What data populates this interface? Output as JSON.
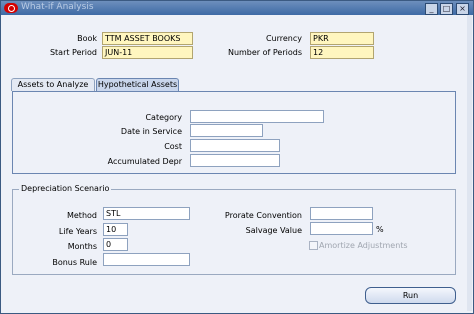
{
  "window": {
    "title": "What-if Analysis",
    "minimize_glyph": "_",
    "maximize_glyph": "□",
    "close_glyph": "×"
  },
  "header": {
    "book_label": "Book",
    "book_value": "TTM ASSET BOOKS",
    "currency_label": "Currency",
    "currency_value": "PKR",
    "start_period_label": "Start Period",
    "start_period_value": "JUN-11",
    "num_periods_label": "Number of Periods",
    "num_periods_value": "12"
  },
  "tabs": [
    {
      "label": "Assets to Analyze",
      "active": false
    },
    {
      "label": "Hypothetical Assets",
      "active": true
    }
  ],
  "hypothetical": {
    "category_label": "Category",
    "category_value": "",
    "date_in_service_label": "Date in Service",
    "date_in_service_value": "",
    "cost_label": "Cost",
    "cost_value": "",
    "accum_depr_label": "Accumulated Depr",
    "accum_depr_value": ""
  },
  "depreciation": {
    "group_title": "Depreciation Scenario",
    "method_label": "Method",
    "method_value": "STL",
    "life_years_label": "Life Years",
    "life_years_value": "10",
    "months_label": "Months",
    "months_value": "0",
    "bonus_rule_label": "Bonus Rule",
    "bonus_rule_value": "",
    "prorate_label": "Prorate Convention",
    "prorate_value": "",
    "salvage_label": "Salvage Value",
    "salvage_value": "",
    "percent_sign": "%",
    "amortize_label": "Amortize Adjustments"
  },
  "actions": {
    "run_label": "Run"
  }
}
